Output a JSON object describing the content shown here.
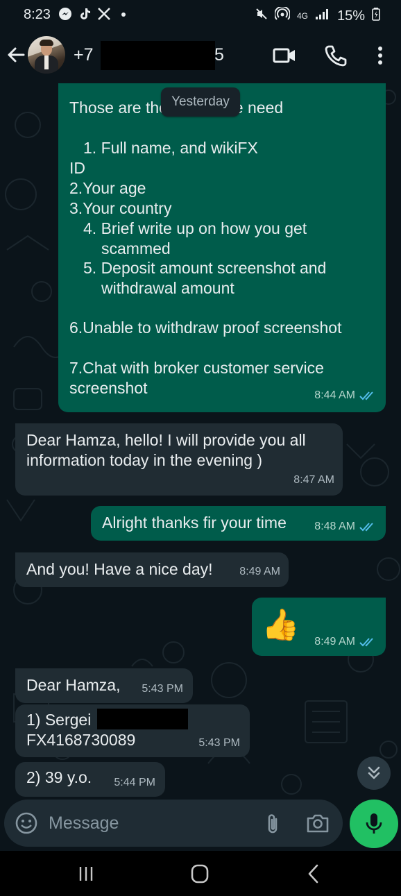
{
  "status_bar": {
    "time": "8:23",
    "battery": "15%",
    "network": "4G",
    "icons": [
      "messenger-icon",
      "tiktok-icon",
      "x-icon",
      "dot-icon",
      "mute-icon",
      "hotspot-icon",
      "signal-icon",
      "battery-icon"
    ]
  },
  "header": {
    "contact_prefix": "+7",
    "contact_suffix": "5",
    "icons": [
      "back-arrow-icon",
      "video-call-icon",
      "phone-icon",
      "more-vert-icon"
    ]
  },
  "chat": {
    "date_chip": "Yesterday",
    "messages": [
      {
        "direction": "out",
        "lines": [
          "Those are the details we need",
          "",
          "1. Full name, and wikiFX",
          "ID",
          "2.Your age",
          "3.Your country",
          "4. Brief write up on how you get",
          "scammed",
          "5. Deposit amount screenshot and",
          "withdrawal amount",
          "",
          "6.Unable to withdraw proof screenshot",
          "",
          "7.Chat with broker customer service",
          "screenshot"
        ],
        "time": "8:44 AM",
        "read": true
      },
      {
        "direction": "in",
        "lines": [
          "Dear Hamza, hello! I will provide you all",
          "information today in the evening )"
        ],
        "time": "8:47 AM"
      },
      {
        "direction": "out",
        "lines": [
          "Alright thanks fir your time"
        ],
        "time": "8:48 AM",
        "read": true
      },
      {
        "direction": "in",
        "lines": [
          "And you! Have a nice day!"
        ],
        "time": "8:49 AM"
      },
      {
        "direction": "out",
        "emoji": "👍",
        "time": "8:49 AM",
        "read": true
      },
      {
        "direction": "in",
        "lines": [
          "Dear Hamza,"
        ],
        "time": "5:43 PM"
      },
      {
        "direction": "in",
        "lines": [
          "1) Sergei",
          "FX4168730089"
        ],
        "time": "5:43 PM"
      },
      {
        "direction": "in",
        "lines": [
          "2) 39 y.o."
        ],
        "time": "5:44 PM"
      }
    ]
  },
  "input": {
    "placeholder": "Message",
    "icons": [
      "emoji-icon",
      "attach-icon",
      "camera-icon",
      "mic-icon"
    ]
  },
  "nav_bar": {
    "icons": [
      "recents-icon",
      "home-icon",
      "back-icon"
    ]
  },
  "colors": {
    "background": "#0b141a",
    "outgoing_bubble": "#005c4b",
    "incoming_bubble": "#202c33",
    "read_ticks": "#53bdeb",
    "mic_button": "#21c063"
  }
}
